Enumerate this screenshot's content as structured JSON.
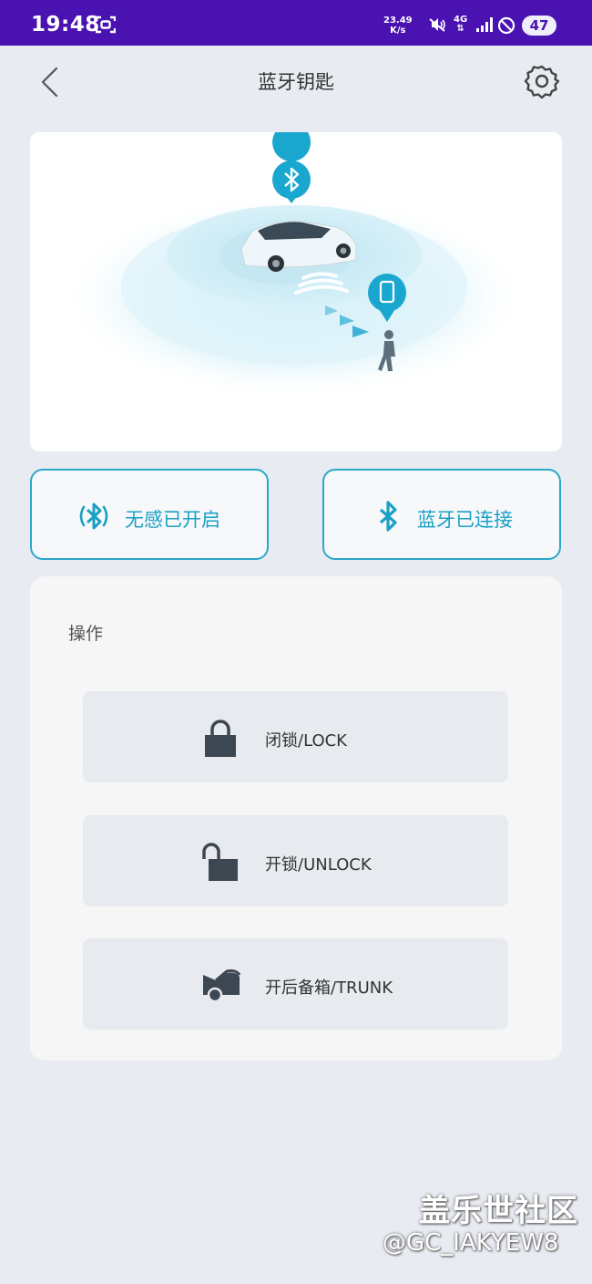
{
  "status_bar": {
    "time": "19:48",
    "speed_value": "23.49",
    "speed_unit": "K/s",
    "network": "4G",
    "battery": "47"
  },
  "header": {
    "title": "蓝牙钥匙"
  },
  "status_buttons": {
    "keyless": {
      "label": "无感已开启",
      "icon": "bluetooth-keyless-icon"
    },
    "bluetooth": {
      "label": "蓝牙已连接",
      "icon": "bluetooth-icon"
    }
  },
  "operations": {
    "title": "操作",
    "items": [
      {
        "label": "闭锁/LOCK",
        "icon": "lock-icon"
      },
      {
        "label": "开锁/UNLOCK",
        "icon": "unlock-icon"
      },
      {
        "label": "开后备箱/TRUNK",
        "icon": "trunk-icon"
      }
    ]
  },
  "watermark": {
    "site": "盖乐世社区",
    "user": "@GC_IAKYEW8"
  },
  "colors": {
    "accent": "#1aa0c4",
    "status_bar": "#4a12b0",
    "background": "#e8ebf1"
  }
}
